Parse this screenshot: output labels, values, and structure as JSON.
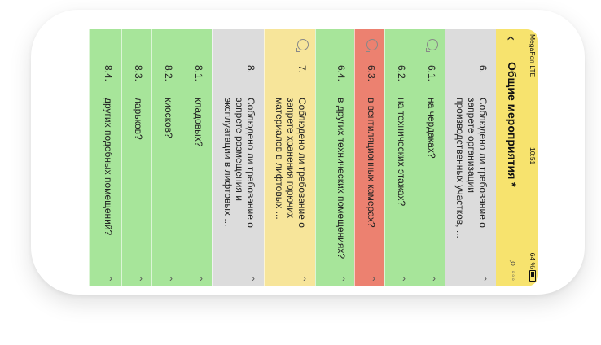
{
  "status": {
    "carrier": "MegaFon  LTE",
    "time": "10:51",
    "battery": "64 %"
  },
  "header": {
    "title": "Общие мероприятия *",
    "back_icon": "chevron-left-icon",
    "search_icon": "search-icon",
    "more": "◦◦◦"
  },
  "colors": {
    "header": "#f7e36e",
    "green": "#a7e59a",
    "grey": "#dcdcdc",
    "red": "#ec8170",
    "yellow": "#f7e59a"
  },
  "rows": [
    {
      "num": "6.",
      "text": "Соблюдено ли требование о запрете организации производственных участков, ...",
      "color": "#dcdcdc",
      "comment": false
    },
    {
      "num": "6.1.",
      "text": "на чердаках?",
      "color": "#a7e59a",
      "comment": true
    },
    {
      "num": "6.2.",
      "text": "на технических этажах?",
      "color": "#a7e59a",
      "comment": false
    },
    {
      "num": "6.3.",
      "text": "в вентиляционных камерах?",
      "color": "#ec8170",
      "comment": true
    },
    {
      "num": "6.4.",
      "text": "в других технических помещениях?",
      "color": "#a7e59a",
      "comment": false
    },
    {
      "num": "7.",
      "text": "Соблюдено ли требование о запрете хранения горючих материалов в лифтовых ...",
      "color": "#f7e59a",
      "comment": true
    },
    {
      "num": "8.",
      "text": "Соблюдено ли требование о запрете размещения и эксплуатации в лифтовых ...",
      "color": "#dcdcdc",
      "comment": false
    },
    {
      "num": "8.1.",
      "text": "кладовых?",
      "color": "#a7e59a",
      "comment": false
    },
    {
      "num": "8.2.",
      "text": "киосков?",
      "color": "#a7e59a",
      "comment": false
    },
    {
      "num": "8.3.",
      "text": "ларьков?",
      "color": "#a7e59a",
      "comment": false
    },
    {
      "num": "8.4.",
      "text": "других подобных помещений?",
      "color": "#a7e59a",
      "comment": false
    }
  ]
}
